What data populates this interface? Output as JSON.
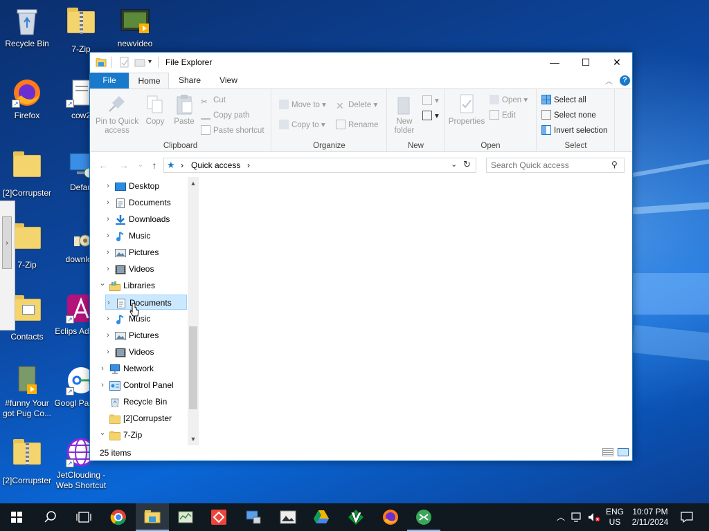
{
  "desktop": {
    "icons": [
      {
        "label": "Recycle Bin",
        "icon": "recycle-bin-icon"
      },
      {
        "label": "7-Zip",
        "icon": "zip-folder-icon"
      },
      {
        "label": "newvideo",
        "icon": "video-file-icon"
      },
      {
        "label": "Firefox",
        "icon": "firefox-icon"
      },
      {
        "label": "cow2",
        "icon": "document-icon"
      },
      {
        "label": "[2]Corrupster",
        "icon": "folder-icon"
      },
      {
        "label": "Defau",
        "icon": "computer-icon"
      },
      {
        "label": "7-Zip",
        "icon": "folder-icon"
      },
      {
        "label": "downloa",
        "icon": "archive-icon"
      },
      {
        "label": "Contacts",
        "icon": "contacts-folder-icon"
      },
      {
        "label": "Eclips Adoptiu",
        "icon": "eclipse-adoptium-icon"
      },
      {
        "label": "#funny Your got Pug Co...",
        "icon": "video-file-icon"
      },
      {
        "label": "Googl Passwo",
        "icon": "google-password-icon"
      },
      {
        "label": "[2]Corrupster",
        "icon": "zip-folder-icon"
      },
      {
        "label": "JetClouding - Web Shortcut",
        "icon": "globe-icon"
      }
    ]
  },
  "window": {
    "title": "File Explorer",
    "controls": {
      "minimize": "—",
      "maximize": "☐",
      "close": "✕"
    }
  },
  "ribbon": {
    "tabs": [
      "File",
      "Home",
      "Share",
      "View"
    ],
    "active_tab": "Home",
    "groups": {
      "clipboard": {
        "label": "Clipboard",
        "pin": "Pin to Quick access",
        "copy": "Copy",
        "paste": "Paste",
        "cut": "Cut",
        "copy_path": "Copy path",
        "paste_shortcut": "Paste shortcut"
      },
      "organize": {
        "label": "Organize",
        "move_to": "Move to",
        "copy_to": "Copy to",
        "delete": "Delete",
        "rename": "Rename"
      },
      "new": {
        "label": "New",
        "new_folder": "New folder"
      },
      "open": {
        "label": "Open",
        "properties": "Properties",
        "open": "Open",
        "edit": "Edit"
      },
      "select": {
        "label": "Select",
        "select_all": "Select all",
        "select_none": "Select none",
        "invert": "Invert selection"
      }
    }
  },
  "address": {
    "path": "Quick access",
    "search_placeholder": "Search Quick access"
  },
  "navpane": {
    "items": [
      {
        "label": "Desktop",
        "icon": "desktop-icon",
        "expanded": false
      },
      {
        "label": "Documents",
        "icon": "documents-icon",
        "expanded": false
      },
      {
        "label": "Downloads",
        "icon": "downloads-icon",
        "expanded": false
      },
      {
        "label": "Music",
        "icon": "music-icon",
        "expanded": false
      },
      {
        "label": "Pictures",
        "icon": "pictures-icon",
        "expanded": false
      },
      {
        "label": "Videos",
        "icon": "videos-icon",
        "expanded": false
      },
      {
        "label": "Libraries",
        "icon": "libraries-icon",
        "expanded": true
      },
      {
        "label": "Documents",
        "icon": "documents-icon",
        "expanded": false,
        "selected": true
      },
      {
        "label": "Music",
        "icon": "music-icon",
        "expanded": false
      },
      {
        "label": "Pictures",
        "icon": "pictures-icon",
        "expanded": false
      },
      {
        "label": "Videos",
        "icon": "videos-icon",
        "expanded": false
      },
      {
        "label": "Network",
        "icon": "network-icon",
        "expanded": false
      },
      {
        "label": "Control Panel",
        "icon": "control-panel-icon",
        "expanded": false
      },
      {
        "label": "Recycle Bin",
        "icon": "recycle-bin-icon",
        "expanded": false
      },
      {
        "label": "[2]Corrupster",
        "icon": "folder-icon",
        "expanded": false
      },
      {
        "label": "7-Zip",
        "icon": "folder-icon",
        "expanded": true
      }
    ]
  },
  "status": {
    "item_count": "25 items"
  },
  "taskbar": {
    "apps": [
      "start-icon",
      "search-icon",
      "task-view-icon",
      "chrome-icon",
      "file-explorer-icon",
      "task-manager-icon",
      "anydesk-icon",
      "network-tool-icon",
      "photo-viewer-icon",
      "drive-icon",
      "vim-icon",
      "firefox-icon",
      "remote-desktop-icon"
    ],
    "language": "ENG",
    "region": "US",
    "time": "10:07 PM",
    "date": "2/11/2024"
  },
  "colors": {
    "accent": "#1979ca",
    "selection": "#cce8ff",
    "taskbar": "#101820"
  }
}
